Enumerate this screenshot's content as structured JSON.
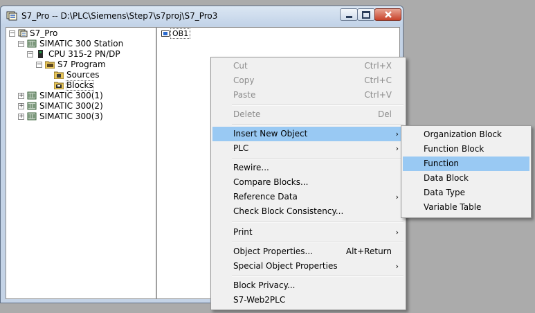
{
  "window": {
    "title": "S7_Pro -- D:\\PLC\\Siemens\\Step7\\s7proj\\S7_Pro3",
    "controls": {
      "minimize": "minimize-icon",
      "maximize": "maximize-icon",
      "close": "close-icon"
    }
  },
  "tree": {
    "root": "S7_Pro",
    "station": "SIMATIC 300 Station",
    "cpu": "CPU 315-2 PN/DP",
    "program": "S7 Program",
    "sources": "Sources",
    "blocks": "Blocks",
    "s300_1": "SIMATIC 300(1)",
    "s300_2": "SIMATIC 300(2)",
    "s300_3": "SIMATIC 300(3)"
  },
  "content": {
    "block": "OB1"
  },
  "context_menu": {
    "cut": {
      "label": "Cut",
      "shortcut": "Ctrl+X"
    },
    "copy": {
      "label": "Copy",
      "shortcut": "Ctrl+C"
    },
    "paste": {
      "label": "Paste",
      "shortcut": "Ctrl+V"
    },
    "delete": {
      "label": "Delete",
      "shortcut": "Del"
    },
    "insert_new_object": {
      "label": "Insert New Object"
    },
    "plc": {
      "label": "PLC"
    },
    "rewire": {
      "label": "Rewire..."
    },
    "compare_blocks": {
      "label": "Compare Blocks..."
    },
    "reference_data": {
      "label": "Reference Data"
    },
    "check_consistency": {
      "label": "Check Block Consistency..."
    },
    "print": {
      "label": "Print"
    },
    "object_properties": {
      "label": "Object Properties...",
      "shortcut": "Alt+Return"
    },
    "special_object_properties": {
      "label": "Special Object Properties"
    },
    "block_privacy": {
      "label": "Block Privacy..."
    },
    "s7_web2plc": {
      "label": "S7-Web2PLC"
    }
  },
  "submenu": {
    "organization_block": "Organization Block",
    "function_block": "Function Block",
    "function": "Function",
    "data_block": "Data Block",
    "data_type": "Data Type",
    "variable_table": "Variable Table"
  },
  "colors": {
    "highlight": "#99c9f3",
    "desktop": "#ababab",
    "close_button": "#c8432b"
  }
}
